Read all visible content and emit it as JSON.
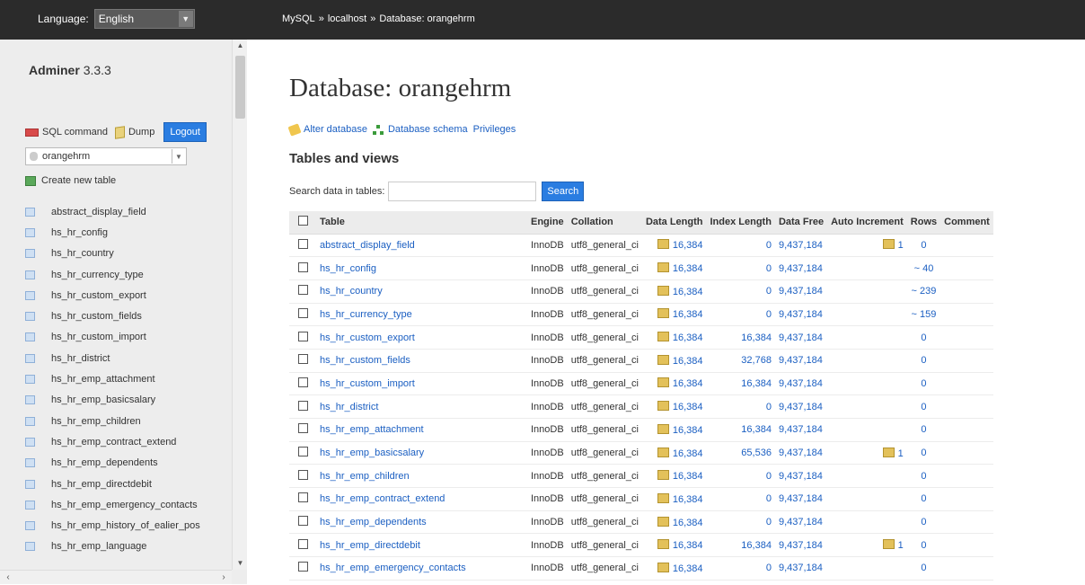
{
  "topbar": {
    "language_label": "Language:",
    "language_value": "English",
    "breadcrumb": [
      "MySQL",
      "localhost",
      "Database: orangehrm"
    ],
    "breadcrumb_sep": "»"
  },
  "sidebar": {
    "brand": "Adminer",
    "version": "3.3.3",
    "sql_command": "SQL command",
    "dump": "Dump",
    "logout": "Logout",
    "db_select": "orangehrm",
    "create_table": "Create new table",
    "tables": [
      "abstract_display_field",
      "hs_hr_config",
      "hs_hr_country",
      "hs_hr_currency_type",
      "hs_hr_custom_export",
      "hs_hr_custom_fields",
      "hs_hr_custom_import",
      "hs_hr_district",
      "hs_hr_emp_attachment",
      "hs_hr_emp_basicsalary",
      "hs_hr_emp_children",
      "hs_hr_emp_contract_extend",
      "hs_hr_emp_dependents",
      "hs_hr_emp_directdebit",
      "hs_hr_emp_emergency_contacts",
      "hs_hr_emp_history_of_ealier_pos",
      "hs_hr_emp_language"
    ]
  },
  "main": {
    "title": "Database: orangehrm",
    "links": {
      "alter": "Alter database",
      "schema": "Database schema",
      "privileges": "Privileges"
    },
    "tables_heading": "Tables and views",
    "search_label": "Search data in tables:",
    "search_button": "Search",
    "columns": [
      "Table",
      "Engine",
      "Collation",
      "Data Length",
      "Index Length",
      "Data Free",
      "Auto Increment",
      "Rows",
      "Comment"
    ],
    "rows": [
      {
        "name": "abstract_display_field",
        "engine": "InnoDB",
        "collation": "utf8_general_ci",
        "data_length": "16,384",
        "index_length": "0",
        "data_free": "9,437,184",
        "auto_increment": "1",
        "rows": "0"
      },
      {
        "name": "hs_hr_config",
        "engine": "InnoDB",
        "collation": "utf8_general_ci",
        "data_length": "16,384",
        "index_length": "0",
        "data_free": "9,437,184",
        "auto_increment": "",
        "rows": "~ 40"
      },
      {
        "name": "hs_hr_country",
        "engine": "InnoDB",
        "collation": "utf8_general_ci",
        "data_length": "16,384",
        "index_length": "0",
        "data_free": "9,437,184",
        "auto_increment": "",
        "rows": "~ 239"
      },
      {
        "name": "hs_hr_currency_type",
        "engine": "InnoDB",
        "collation": "utf8_general_ci",
        "data_length": "16,384",
        "index_length": "0",
        "data_free": "9,437,184",
        "auto_increment": "",
        "rows": "~ 159"
      },
      {
        "name": "hs_hr_custom_export",
        "engine": "InnoDB",
        "collation": "utf8_general_ci",
        "data_length": "16,384",
        "index_length": "16,384",
        "data_free": "9,437,184",
        "auto_increment": "",
        "rows": "0"
      },
      {
        "name": "hs_hr_custom_fields",
        "engine": "InnoDB",
        "collation": "utf8_general_ci",
        "data_length": "16,384",
        "index_length": "32,768",
        "data_free": "9,437,184",
        "auto_increment": "",
        "rows": "0"
      },
      {
        "name": "hs_hr_custom_import",
        "engine": "InnoDB",
        "collation": "utf8_general_ci",
        "data_length": "16,384",
        "index_length": "16,384",
        "data_free": "9,437,184",
        "auto_increment": "",
        "rows": "0"
      },
      {
        "name": "hs_hr_district",
        "engine": "InnoDB",
        "collation": "utf8_general_ci",
        "data_length": "16,384",
        "index_length": "0",
        "data_free": "9,437,184",
        "auto_increment": "",
        "rows": "0"
      },
      {
        "name": "hs_hr_emp_attachment",
        "engine": "InnoDB",
        "collation": "utf8_general_ci",
        "data_length": "16,384",
        "index_length": "16,384",
        "data_free": "9,437,184",
        "auto_increment": "",
        "rows": "0"
      },
      {
        "name": "hs_hr_emp_basicsalary",
        "engine": "InnoDB",
        "collation": "utf8_general_ci",
        "data_length": "16,384",
        "index_length": "65,536",
        "data_free": "9,437,184",
        "auto_increment": "1",
        "rows": "0"
      },
      {
        "name": "hs_hr_emp_children",
        "engine": "InnoDB",
        "collation": "utf8_general_ci",
        "data_length": "16,384",
        "index_length": "0",
        "data_free": "9,437,184",
        "auto_increment": "",
        "rows": "0"
      },
      {
        "name": "hs_hr_emp_contract_extend",
        "engine": "InnoDB",
        "collation": "utf8_general_ci",
        "data_length": "16,384",
        "index_length": "0",
        "data_free": "9,437,184",
        "auto_increment": "",
        "rows": "0"
      },
      {
        "name": "hs_hr_emp_dependents",
        "engine": "InnoDB",
        "collation": "utf8_general_ci",
        "data_length": "16,384",
        "index_length": "0",
        "data_free": "9,437,184",
        "auto_increment": "",
        "rows": "0"
      },
      {
        "name": "hs_hr_emp_directdebit",
        "engine": "InnoDB",
        "collation": "utf8_general_ci",
        "data_length": "16,384",
        "index_length": "16,384",
        "data_free": "9,437,184",
        "auto_increment": "1",
        "rows": "0"
      },
      {
        "name": "hs_hr_emp_emergency_contacts",
        "engine": "InnoDB",
        "collation": "utf8_general_ci",
        "data_length": "16,384",
        "index_length": "0",
        "data_free": "9,437,184",
        "auto_increment": "",
        "rows": "0"
      }
    ]
  },
  "icons": {
    "sql": "sql-command-icon",
    "dump": "dump-icon",
    "database": "database-icon",
    "create": "create-table-icon",
    "table": "table-icon",
    "alter": "pencil-icon",
    "schema": "schema-icon",
    "edit": "pencil-icon"
  },
  "colors": {
    "topbar": "#2b2b2b",
    "sidebar": "#ededed",
    "link": "#1b5fc2",
    "button": "#2a7de1"
  }
}
